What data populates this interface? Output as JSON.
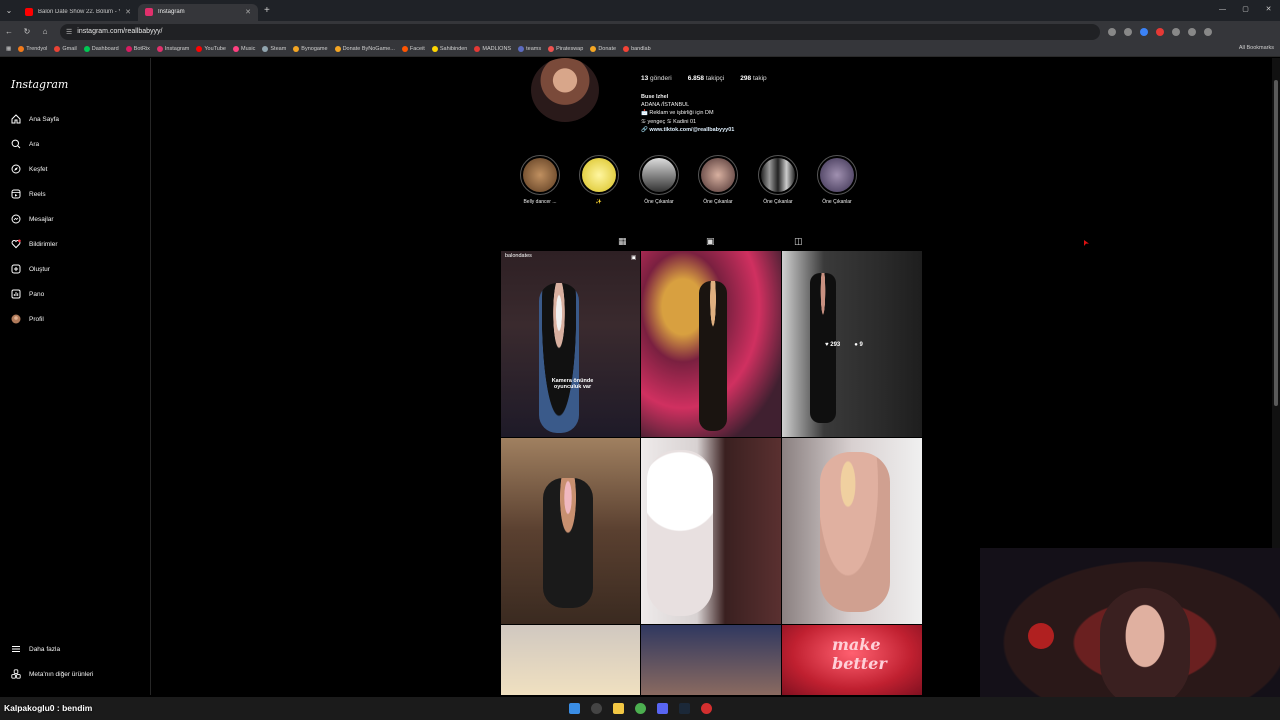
{
  "browser": {
    "tabs": [
      {
        "label": "Balon Date Show 22. Bölüm - Y",
        "favicon_color": "#ff0000"
      },
      {
        "label": "Instagram",
        "favicon_color": "#e1306c"
      }
    ],
    "url": "instagram.com/reallbabyyy/",
    "bookmarks": [
      {
        "label": "Trendyol",
        "color": "#f27a1a"
      },
      {
        "label": "Gmail",
        "color": "#ea4335"
      },
      {
        "label": "Dashboard",
        "color": "#00c853"
      },
      {
        "label": "BotRix",
        "color": "#d81b60"
      },
      {
        "label": "Instagram",
        "color": "#e1306c"
      },
      {
        "label": "YouTube",
        "color": "#ff0000"
      },
      {
        "label": "Music",
        "color": "#ff4081"
      },
      {
        "label": "Steam",
        "color": "#90a4ae"
      },
      {
        "label": "Bynogame",
        "color": "#f5a623"
      },
      {
        "label": "Donate ByNoGame...",
        "color": "#f5a623"
      },
      {
        "label": "Faceit",
        "color": "#ff5500"
      },
      {
        "label": "Sahibinden",
        "color": "#ffd600"
      },
      {
        "label": "MADLIONS",
        "color": "#e53935"
      },
      {
        "label": "teams",
        "color": "#5c6bc0"
      },
      {
        "label": "Pirateswap",
        "color": "#ef5350"
      },
      {
        "label": "Donate",
        "color": "#f5a623"
      },
      {
        "label": "bandlab",
        "color": "#f44336"
      }
    ],
    "all_bookmarks": "All Bookmarks"
  },
  "sidebar": {
    "logo": "Instagram",
    "items": [
      {
        "label": "Ana Sayfa",
        "icon": "home-icon"
      },
      {
        "label": "Ara",
        "icon": "search-icon"
      },
      {
        "label": "Keşfet",
        "icon": "compass-icon"
      },
      {
        "label": "Reels",
        "icon": "reels-icon"
      },
      {
        "label": "Mesajlar",
        "icon": "messenger-icon"
      },
      {
        "label": "Bildirimler",
        "icon": "heart-icon"
      },
      {
        "label": "Oluştur",
        "icon": "plus-square-icon"
      },
      {
        "label": "Pano",
        "icon": "dashboard-icon"
      },
      {
        "label": "Profil",
        "icon": "avatar"
      }
    ],
    "more": "Daha fazla",
    "meta": "Meta'nın diğer ürünleri"
  },
  "profile": {
    "posts_count": "13",
    "posts_label": "gönderi",
    "followers_count": "6.858",
    "followers_label": "takipçi",
    "following_count": "298",
    "following_label": "takip",
    "name": "Buse Izhel",
    "bio_lines": [
      "ADANA /İSTANBUL",
      "📩 Reklam ve işbirliği için DM",
      "♋ yengeç ♋ Kadini 01"
    ],
    "link": "www.tiktok.com/@reallbabyyy01"
  },
  "highlights": [
    {
      "label": "Belly dancer ...",
      "color": "#7a5a3a"
    },
    {
      "label": "✨",
      "color": "#e8d84a"
    },
    {
      "label": "Öne Çıkanlar",
      "color": "#8a8f98"
    },
    {
      "label": "Öne Çıkanlar",
      "color": "#6a5a5a"
    },
    {
      "label": "Öne Çıkanlar",
      "color": "#4a4a4a"
    },
    {
      "label": "Öne Çıkanlar",
      "color": "#5a4a6a"
    }
  ],
  "posts": [
    {
      "bg": "#3a2a2e",
      "accent": "#c9a7a0",
      "overlay": "Kamera önünde oyunculuk var",
      "user": "balondates"
    },
    {
      "bg": "#7a2040",
      "accent": "#d8a040",
      "overlay": ""
    },
    {
      "bg": "#2b2b2b",
      "accent": "#4a4040",
      "overlay": "",
      "likes": "293",
      "comments": "9"
    },
    {
      "bg": "#5a4030",
      "accent": "#c89070",
      "overlay": ""
    },
    {
      "bg": "#3a2020",
      "accent": "#e8e0e0",
      "overlay": ""
    },
    {
      "bg": "#8a8080",
      "accent": "#e0b0a0",
      "overlay": ""
    },
    {
      "bg": "#d0c8c0",
      "accent": "#e0b080",
      "overlay": ""
    },
    {
      "bg": "#303860",
      "accent": "#d09070",
      "overlay": ""
    },
    {
      "bg": "#c02030",
      "accent": "#ff5060",
      "overlay": "make better"
    }
  ],
  "chat": {
    "line": "Kalpakoglu0 : bendim"
  }
}
